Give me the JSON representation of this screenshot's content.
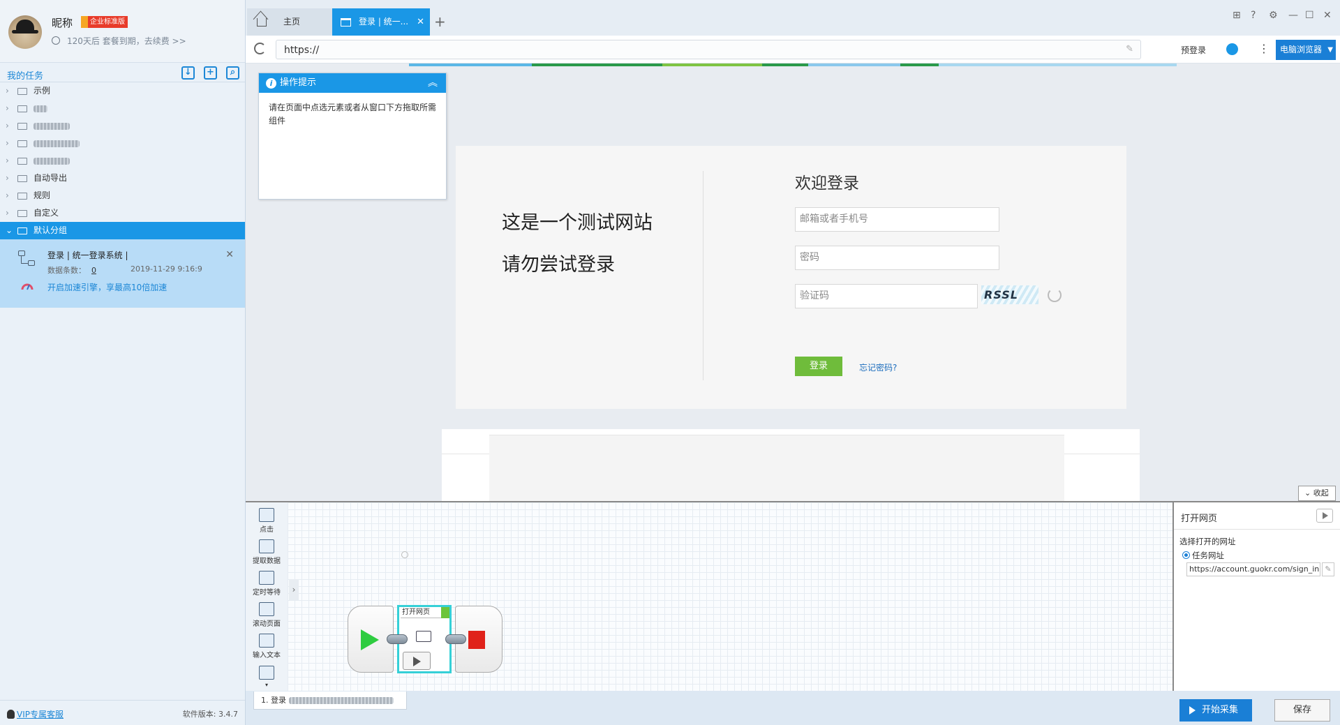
{
  "profile": {
    "nickname": "昵称",
    "edition": "企业标准版",
    "expiry": "120天后 套餐到期，去续费 >>"
  },
  "tasks": {
    "title": "我的任务",
    "items": [
      {
        "label": "示例"
      },
      {
        "label": ""
      },
      {
        "label": ""
      },
      {
        "label": ""
      },
      {
        "label": ""
      },
      {
        "label": "自动导出"
      },
      {
        "label": "规则"
      },
      {
        "label": "自定义"
      },
      {
        "label": "默认分组"
      }
    ],
    "task": {
      "name": "登录 | 统一登录系统 |",
      "count_label": "数据条数：",
      "count": "0",
      "date": "2019-11-29 9:16:9",
      "accelerate": "开启加速引擎，享最高10倍加速"
    }
  },
  "footer": {
    "vip": "VIP专属客服",
    "version": "软件版本: 3.4.7"
  },
  "tabs": {
    "home": "主页",
    "login": "登录 | 统一..."
  },
  "address": {
    "url": "https://",
    "prelogin": "预登录",
    "browser": "电脑浏览器"
  },
  "hint": {
    "title": "操作提示",
    "body": "请在页面中点选元素或者从窗口下方拖取所需组件"
  },
  "site": {
    "line1": "这是一个测试网站",
    "line2": "请勿尝试登录",
    "welcome": "欢迎登录",
    "email_placeholder": "邮箱或者手机号",
    "password_placeholder": "密码",
    "captcha_placeholder": "验证码",
    "captcha_text": "RSSL",
    "login_button": "登录",
    "forgot": "忘记密码?"
  },
  "collapse_label": "收起",
  "toolbox": [
    {
      "label": "点击"
    },
    {
      "label": "提取数据"
    },
    {
      "label": "定时等待"
    },
    {
      "label": "滚动页面"
    },
    {
      "label": "输入文本"
    }
  ],
  "workflow": {
    "open_node_title": "打开网页",
    "step_tab": "1. 登录"
  },
  "props": {
    "title": "打开网页",
    "label": "选择打开的网址",
    "radio": "任务网址",
    "url": "https://account.guokr.com/sign_in"
  },
  "actions": {
    "start": "开始采集",
    "save": "保存"
  },
  "colors": {
    "accent": "#1a97e6",
    "login_green": "#6fbc3b",
    "start_green": "#2ecc40",
    "stop_red": "#e0221a"
  }
}
